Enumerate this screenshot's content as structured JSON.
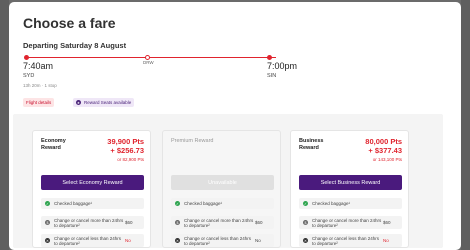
{
  "modal": {
    "title": "Choose a fare",
    "departing": "Departing Saturday 8 August",
    "route": {
      "depart_time": "7:40am",
      "arrive_time": "7:00pm",
      "origin": "SYD",
      "destination": "SIN",
      "stopover": "DRW",
      "duration": "13h 20m · 1 stop"
    },
    "chips": {
      "flight_details": "Flight details",
      "reward_seats": "Reward Seats available"
    }
  },
  "fares": [
    {
      "name": "Economy Reward",
      "points": "39,900 Pts",
      "tax": "+ $256.73",
      "alt": "or 82,900 Pts",
      "cta": "Select Economy Reward",
      "features": [
        {
          "text": "Checked baggage¹",
          "value": ""
        },
        {
          "text": "Change or cancel more than 24hrs to departure²",
          "value": "$60"
        },
        {
          "text": "Change or cancel less than 24hrs to departure²",
          "value": "No"
        }
      ]
    },
    {
      "name": "Premium Reward",
      "cta": "Unavailable",
      "features": [
        {
          "text": "Checked baggage¹",
          "value": ""
        },
        {
          "text": "Change or cancel more than 24hrs to departure²",
          "value": "$60"
        },
        {
          "text": "Change or cancel less than 24hrs to departure²",
          "value": "No"
        }
      ]
    },
    {
      "name": "Business Reward",
      "points": "80,000 Pts",
      "tax": "+ $377.43",
      "alt": "or 143,100 Pts",
      "cta": "Select Business Reward",
      "features": [
        {
          "text": "Checked baggage¹",
          "value": ""
        },
        {
          "text": "Change or cancel more than 24hrs to departure²",
          "value": "$60"
        },
        {
          "text": "Change or cancel less than 24hrs to departure²",
          "value": "No"
        }
      ]
    }
  ],
  "colors": {
    "accent_red": "#e0242e",
    "brand_purple": "#4a1a7d",
    "included_green": "#2ea44f"
  }
}
